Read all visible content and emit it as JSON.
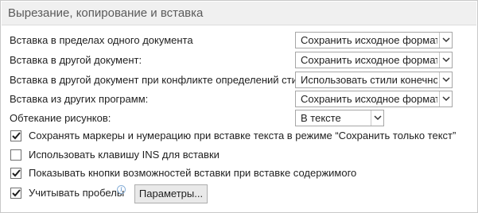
{
  "section": {
    "title": "Вырезание, копирование и вставка"
  },
  "rows": [
    {
      "label": "Вставка в пределах одного документа",
      "value": "Сохранить исходное форматирование"
    },
    {
      "label": "Вставка в другой документ:",
      "value": "Сохранить исходное форматирование"
    },
    {
      "label": "Вставка в другой документ при конфликте определений стилей:",
      "value": "Использовать стили конечного документа"
    },
    {
      "label": "Вставка из других программ:",
      "value": "Сохранить исходное форматирование"
    },
    {
      "label": "Обтекание рисунков:",
      "value": "В тексте"
    }
  ],
  "checkboxes": [
    {
      "label": "Сохранять маркеры и нумерацию при вставке текста в режиме “Сохранить только текст”",
      "checked": true
    },
    {
      "label": "Использовать клавишу INS для вставки",
      "checked": false
    },
    {
      "label": "Показывать кнопки возможностей вставки при вставке содержимого",
      "checked": true
    },
    {
      "label": "Учитывать пробелы",
      "checked": true
    }
  ],
  "info_icon": {
    "glyph": "i"
  },
  "settings_button": {
    "label": "Параметры..."
  },
  "colors": {
    "header_bg": "#f0f0f0",
    "header_text": "#5a5a5a",
    "border": "#a6a6a6"
  }
}
